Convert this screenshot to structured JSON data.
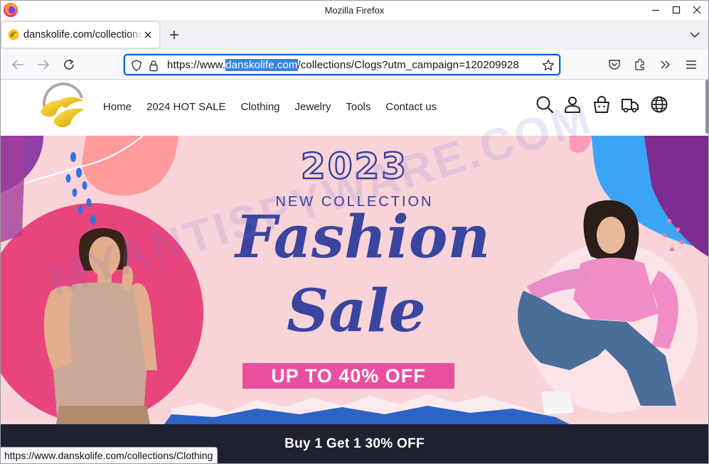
{
  "window": {
    "title": "Mozilla Firefox"
  },
  "tab": {
    "title": "danskolife.com/collections/Clogs"
  },
  "urlbar": {
    "prefix": "https://www.",
    "domain": "danskolife.com",
    "suffix": "/collections/Clogs?utm_campaign=120209928"
  },
  "site": {
    "nav": [
      "Home",
      "2024 HOT SALE",
      "Clothing",
      "Jewelry",
      "Tools",
      "Contact us"
    ],
    "hero": {
      "year": "2023",
      "subtitle": "NEW COLLECTION",
      "line1": "Fashion",
      "line2": "Sale",
      "banner": "UP TO 40% OFF"
    },
    "promo": "Buy 1 Get 1 30% OFF"
  },
  "watermark": "MYANTISPYWARE.COM",
  "status_link": "https://www.danskolife.com/collections/Clothing",
  "colors": {
    "accent": "#0061e0",
    "hero_bg": "#f8d3d8",
    "hero_text": "#3a45a0",
    "banner": "#e94f9e",
    "promo_bg": "#202232"
  }
}
